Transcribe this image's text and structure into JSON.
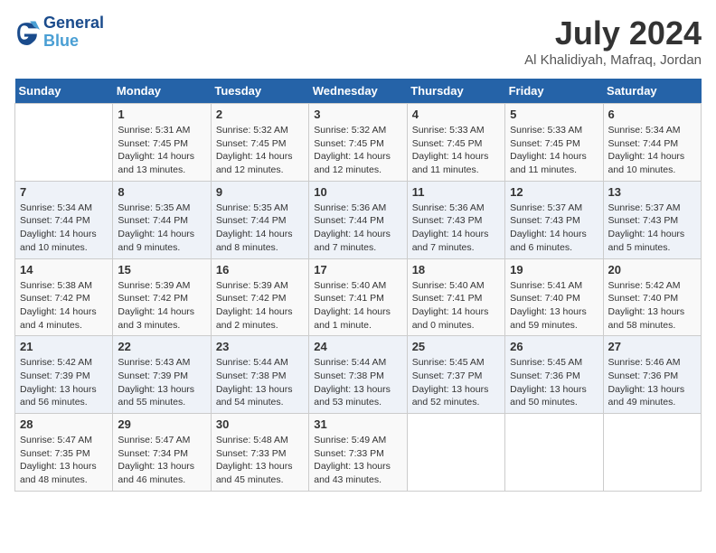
{
  "logo": {
    "line1": "General",
    "line2": "Blue"
  },
  "title": {
    "month_year": "July 2024",
    "location": "Al Khalidiyah, Mafraq, Jordan"
  },
  "days_of_week": [
    "Sunday",
    "Monday",
    "Tuesday",
    "Wednesday",
    "Thursday",
    "Friday",
    "Saturday"
  ],
  "weeks": [
    [
      {
        "day": "",
        "info": ""
      },
      {
        "day": "1",
        "info": "Sunrise: 5:31 AM\nSunset: 7:45 PM\nDaylight: 14 hours\nand 13 minutes."
      },
      {
        "day": "2",
        "info": "Sunrise: 5:32 AM\nSunset: 7:45 PM\nDaylight: 14 hours\nand 12 minutes."
      },
      {
        "day": "3",
        "info": "Sunrise: 5:32 AM\nSunset: 7:45 PM\nDaylight: 14 hours\nand 12 minutes."
      },
      {
        "day": "4",
        "info": "Sunrise: 5:33 AM\nSunset: 7:45 PM\nDaylight: 14 hours\nand 11 minutes."
      },
      {
        "day": "5",
        "info": "Sunrise: 5:33 AM\nSunset: 7:45 PM\nDaylight: 14 hours\nand 11 minutes."
      },
      {
        "day": "6",
        "info": "Sunrise: 5:34 AM\nSunset: 7:44 PM\nDaylight: 14 hours\nand 10 minutes."
      }
    ],
    [
      {
        "day": "7",
        "info": "Sunrise: 5:34 AM\nSunset: 7:44 PM\nDaylight: 14 hours\nand 10 minutes."
      },
      {
        "day": "8",
        "info": "Sunrise: 5:35 AM\nSunset: 7:44 PM\nDaylight: 14 hours\nand 9 minutes."
      },
      {
        "day": "9",
        "info": "Sunrise: 5:35 AM\nSunset: 7:44 PM\nDaylight: 14 hours\nand 8 minutes."
      },
      {
        "day": "10",
        "info": "Sunrise: 5:36 AM\nSunset: 7:44 PM\nDaylight: 14 hours\nand 7 minutes."
      },
      {
        "day": "11",
        "info": "Sunrise: 5:36 AM\nSunset: 7:43 PM\nDaylight: 14 hours\nand 7 minutes."
      },
      {
        "day": "12",
        "info": "Sunrise: 5:37 AM\nSunset: 7:43 PM\nDaylight: 14 hours\nand 6 minutes."
      },
      {
        "day": "13",
        "info": "Sunrise: 5:37 AM\nSunset: 7:43 PM\nDaylight: 14 hours\nand 5 minutes."
      }
    ],
    [
      {
        "day": "14",
        "info": "Sunrise: 5:38 AM\nSunset: 7:42 PM\nDaylight: 14 hours\nand 4 minutes."
      },
      {
        "day": "15",
        "info": "Sunrise: 5:39 AM\nSunset: 7:42 PM\nDaylight: 14 hours\nand 3 minutes."
      },
      {
        "day": "16",
        "info": "Sunrise: 5:39 AM\nSunset: 7:42 PM\nDaylight: 14 hours\nand 2 minutes."
      },
      {
        "day": "17",
        "info": "Sunrise: 5:40 AM\nSunset: 7:41 PM\nDaylight: 14 hours\nand 1 minute."
      },
      {
        "day": "18",
        "info": "Sunrise: 5:40 AM\nSunset: 7:41 PM\nDaylight: 14 hours\nand 0 minutes."
      },
      {
        "day": "19",
        "info": "Sunrise: 5:41 AM\nSunset: 7:40 PM\nDaylight: 13 hours\nand 59 minutes."
      },
      {
        "day": "20",
        "info": "Sunrise: 5:42 AM\nSunset: 7:40 PM\nDaylight: 13 hours\nand 58 minutes."
      }
    ],
    [
      {
        "day": "21",
        "info": "Sunrise: 5:42 AM\nSunset: 7:39 PM\nDaylight: 13 hours\nand 56 minutes."
      },
      {
        "day": "22",
        "info": "Sunrise: 5:43 AM\nSunset: 7:39 PM\nDaylight: 13 hours\nand 55 minutes."
      },
      {
        "day": "23",
        "info": "Sunrise: 5:44 AM\nSunset: 7:38 PM\nDaylight: 13 hours\nand 54 minutes."
      },
      {
        "day": "24",
        "info": "Sunrise: 5:44 AM\nSunset: 7:38 PM\nDaylight: 13 hours\nand 53 minutes."
      },
      {
        "day": "25",
        "info": "Sunrise: 5:45 AM\nSunset: 7:37 PM\nDaylight: 13 hours\nand 52 minutes."
      },
      {
        "day": "26",
        "info": "Sunrise: 5:45 AM\nSunset: 7:36 PM\nDaylight: 13 hours\nand 50 minutes."
      },
      {
        "day": "27",
        "info": "Sunrise: 5:46 AM\nSunset: 7:36 PM\nDaylight: 13 hours\nand 49 minutes."
      }
    ],
    [
      {
        "day": "28",
        "info": "Sunrise: 5:47 AM\nSunset: 7:35 PM\nDaylight: 13 hours\nand 48 minutes."
      },
      {
        "day": "29",
        "info": "Sunrise: 5:47 AM\nSunset: 7:34 PM\nDaylight: 13 hours\nand 46 minutes."
      },
      {
        "day": "30",
        "info": "Sunrise: 5:48 AM\nSunset: 7:33 PM\nDaylight: 13 hours\nand 45 minutes."
      },
      {
        "day": "31",
        "info": "Sunrise: 5:49 AM\nSunset: 7:33 PM\nDaylight: 13 hours\nand 43 minutes."
      },
      {
        "day": "",
        "info": ""
      },
      {
        "day": "",
        "info": ""
      },
      {
        "day": "",
        "info": ""
      }
    ]
  ]
}
